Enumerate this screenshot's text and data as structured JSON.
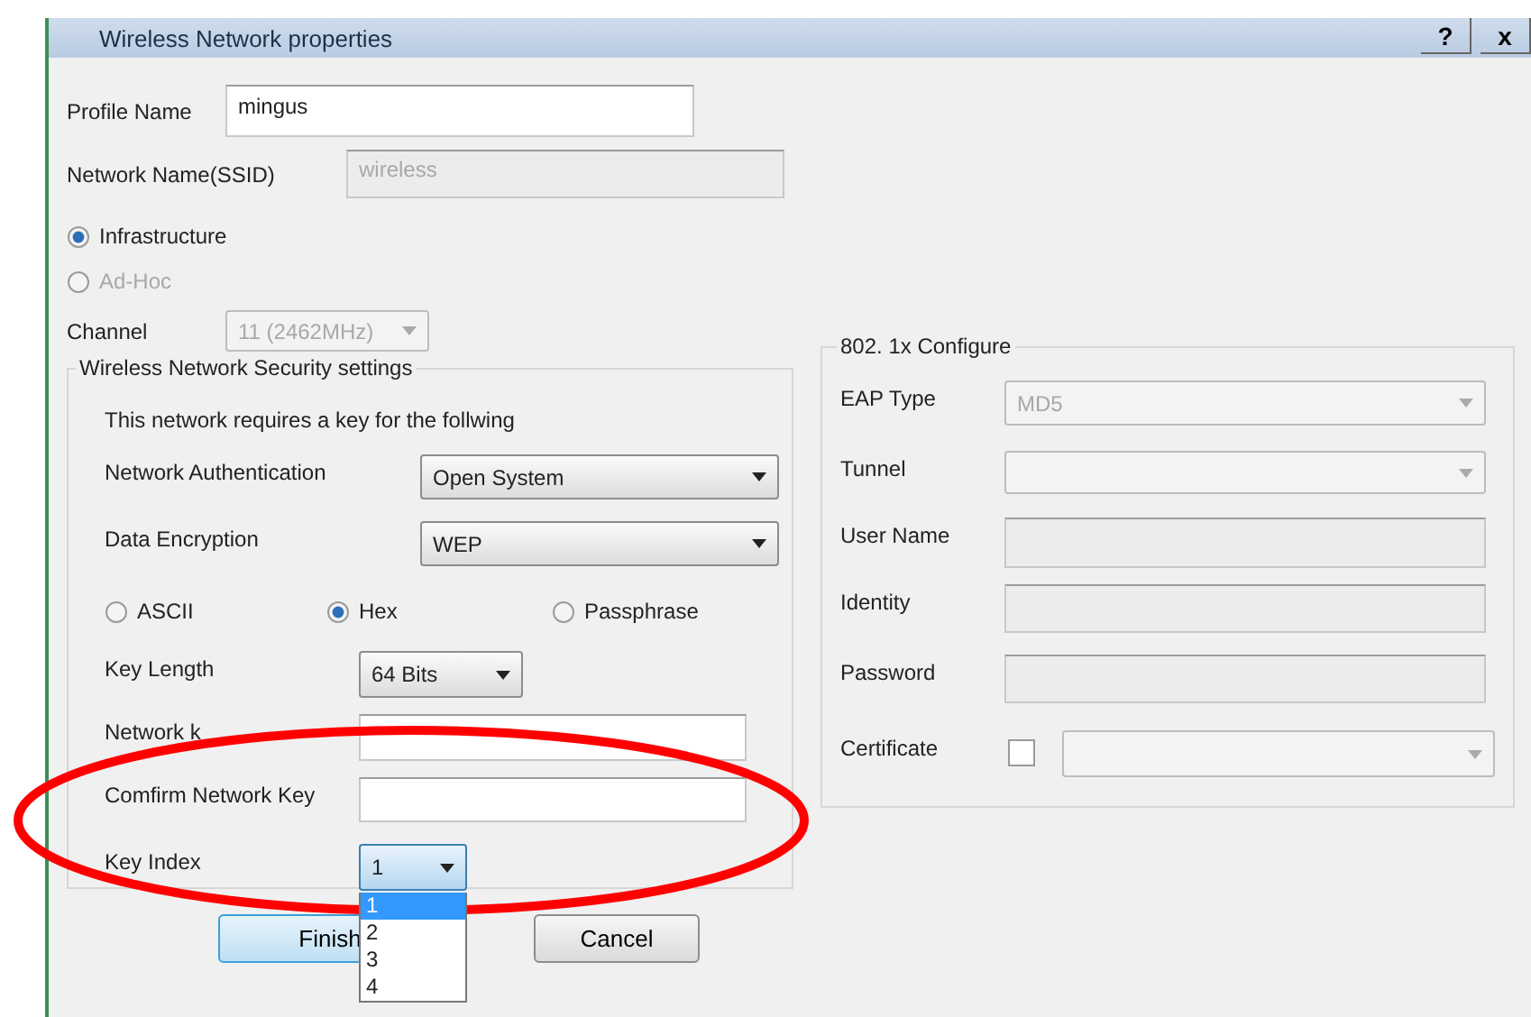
{
  "window": {
    "title": "Wireless Network properties",
    "buttons": [
      "?",
      "x"
    ]
  },
  "profile_name": {
    "label": "Profile Name",
    "value": "mingus",
    "disabled": false
  },
  "network_name": {
    "label": "Network Name(SSID)",
    "value": "wireless",
    "disabled": true
  },
  "mode": [
    {
      "label": "Infrastructure",
      "selected": true,
      "disabled": false
    },
    {
      "label": "Ad-Hoc",
      "selected": false,
      "disabled": true
    }
  ],
  "channel": {
    "label": "Channel",
    "value": "11 (2462MHz)",
    "disabled": true
  },
  "security": {
    "title": "Wireless Network Security settings",
    "note": "This network requires a key for the follwing",
    "authentication": {
      "label": "Network Authentication",
      "value": "Open System"
    },
    "encryption": {
      "label": "Data Encryption",
      "value": "WEP"
    },
    "key_format": [
      {
        "label": "ASCII",
        "selected": false
      },
      {
        "label": "Hex",
        "selected": true
      },
      {
        "label": "Passphrase",
        "selected": false
      }
    ],
    "key_length": {
      "label": "Key Length",
      "value": "64 Bits"
    },
    "network_key": {
      "label": "Network k"
    },
    "confirm_key": {
      "label": "Comfirm Network Key"
    },
    "key_index": {
      "label": "Key Index",
      "value": "1",
      "expanded": true,
      "options": [
        {
          "label": "1",
          "selected": true
        },
        {
          "label": "2",
          "selected": false
        },
        {
          "label": "3",
          "selected": false
        },
        {
          "label": "4",
          "selected": false
        }
      ]
    }
  },
  "buttons": [
    {
      "label": "Finish",
      "default": true
    },
    {
      "label": "Cancel",
      "default": false
    }
  ],
  "dot1x": {
    "title": "802. 1x Configure",
    "fields": [
      {
        "kind": "select",
        "label": "EAP Type",
        "value": "MD5",
        "disabled": true
      },
      {
        "kind": "select",
        "label": "Tunnel",
        "disabled": true
      },
      {
        "kind": "input",
        "label": "User Name",
        "disabled": true
      },
      {
        "kind": "input",
        "label": "Identity",
        "disabled": true
      },
      {
        "kind": "input",
        "label": "Password",
        "disabled": true
      },
      {
        "kind": "certificate",
        "label": "Certificate",
        "checked": false,
        "disabled": true
      }
    ]
  },
  "annotation": {
    "kind": "ellipse",
    "color": "#ff0000"
  }
}
